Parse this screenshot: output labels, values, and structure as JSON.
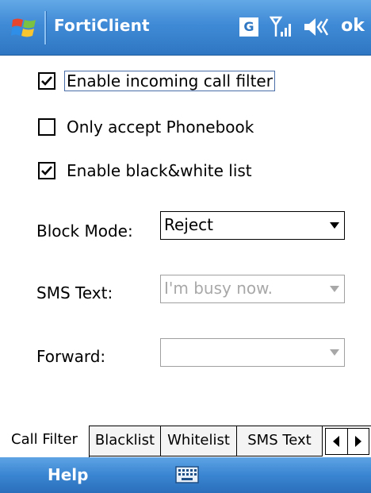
{
  "app": {
    "title": "FortiClient"
  },
  "status": {
    "gprs_badge": "G",
    "ok_label": "ok"
  },
  "options": [
    {
      "label": "Enable incoming call filter",
      "checked": true
    },
    {
      "label": "Only accept Phonebook",
      "checked": false
    },
    {
      "label": "Enable black&white list",
      "checked": true
    }
  ],
  "fields": {
    "block_mode": {
      "label": "Block Mode:",
      "value": "Reject"
    },
    "sms_text": {
      "label": "SMS Text:",
      "value": "I'm busy now."
    },
    "forward": {
      "label": "Forward:",
      "value": ""
    }
  },
  "tabs": [
    {
      "label": "Call Filter"
    },
    {
      "label": "Blacklist"
    },
    {
      "label": "Whitelist"
    },
    {
      "label": "SMS Text"
    }
  ],
  "menu": {
    "left_softkey": "Help"
  },
  "icons": {
    "start": "windows-flag-icon",
    "signal": "signal-strength-icon",
    "volume": "speaker-icon",
    "keyboard": "keyboard-icon"
  },
  "colors": {
    "title_bar": "#3f8ad6",
    "menu_bar": "#3a85d2",
    "disabled_text": "#a8a8a8"
  }
}
